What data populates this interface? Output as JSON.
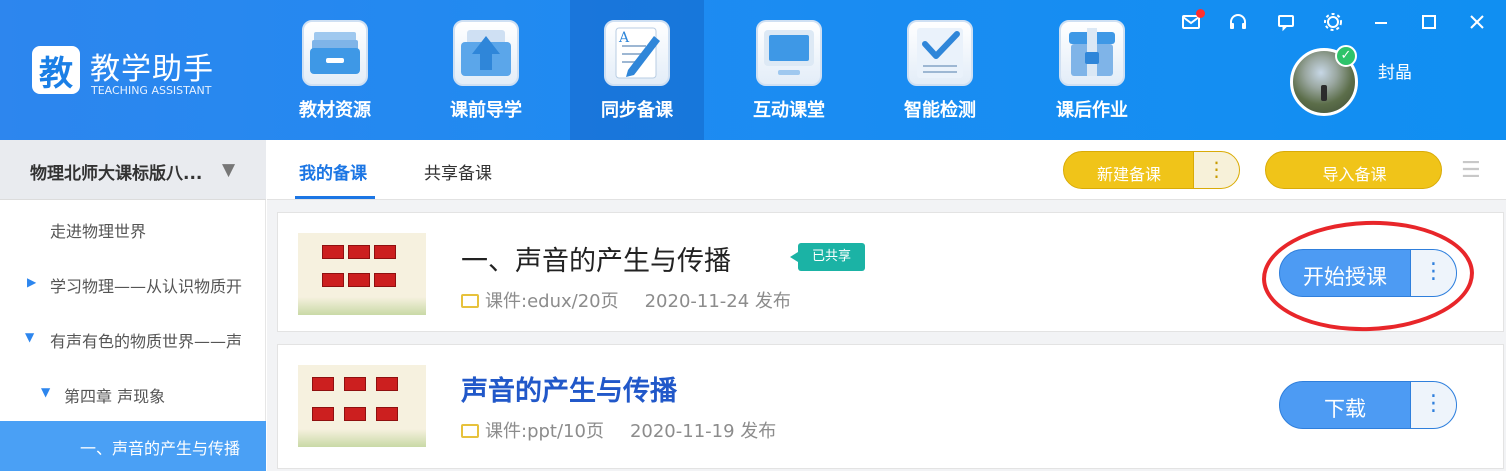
{
  "app": {
    "logo_char": "教",
    "title": "教学助手",
    "subtitle": "TEACHING ASSISTANT"
  },
  "nav": [
    {
      "label": "教材资源",
      "icon": "textbook-folder-icon"
    },
    {
      "label": "课前导学",
      "icon": "upload-arrow-icon"
    },
    {
      "label": "同步备课",
      "icon": "pencil-document-icon",
      "active": true
    },
    {
      "label": "互动课堂",
      "icon": "monitor-icon"
    },
    {
      "label": "智能检测",
      "icon": "checklist-icon"
    },
    {
      "label": "课后作业",
      "icon": "homework-box-icon"
    }
  ],
  "window_controls": [
    "mail-icon",
    "headset-icon",
    "chat-icon",
    "settings-gear-icon",
    "minimize-icon",
    "maximize-icon",
    "close-icon"
  ],
  "user": {
    "name": "封晶",
    "verified": true
  },
  "sidebar": {
    "book_selector": "物理北师大课标版八...",
    "items": [
      {
        "label": "走进物理世界",
        "level": 1,
        "expander": "none"
      },
      {
        "label": "学习物理——从认识物质开",
        "level": 1,
        "expander": "collapsed"
      },
      {
        "label": "有声有色的物质世界——声",
        "level": 1,
        "expander": "expanded"
      },
      {
        "label": "第四章 声现象",
        "level": 2,
        "expander": "expanded"
      },
      {
        "label": "一、声音的产生与传播",
        "level": 3,
        "expander": "none",
        "selected": true
      }
    ]
  },
  "tabs": [
    {
      "label": "我的备课",
      "active": true
    },
    {
      "label": "共享备课",
      "active": false
    }
  ],
  "toolbar": {
    "new_label": "新建备课",
    "more_glyph": "⋮",
    "import_label": "导入备课",
    "menu_glyph": "☰"
  },
  "lessons": [
    {
      "title": "一、声音的产生与传播",
      "tag": "已共享",
      "meta": "课件:edux/20页",
      "date": "2020-11-24 发布",
      "action": "开始授课"
    },
    {
      "title": "声音的产生与传播",
      "tag": "",
      "meta": "课件:ppt/10页",
      "date": "2020-11-19 发布",
      "action": "下载"
    }
  ],
  "colors": {
    "header": "#1a8cf2",
    "accent_blue": "#1c76e4",
    "yellow_button": "#f0c419",
    "shared_tag": "#1bb3a5",
    "annotation_red": "#e8262a"
  }
}
